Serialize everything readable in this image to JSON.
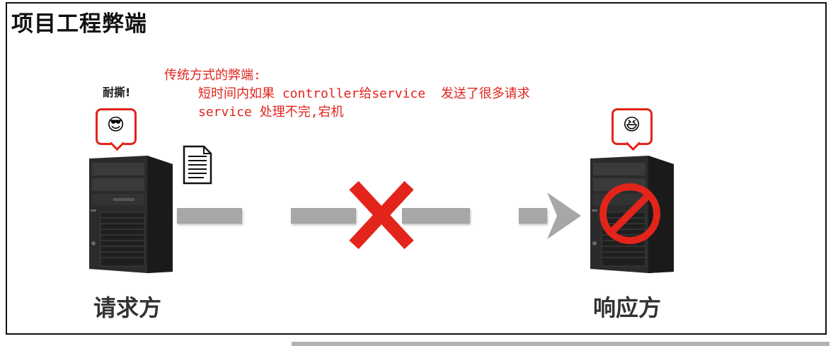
{
  "title": "项目工程弊端",
  "notes": {
    "line1": "传统方式的弊端:",
    "line2": "短时间内如果 controller给service  发送了很多请求",
    "line3": "service 处理不完,宕机"
  },
  "requester": {
    "speech": "耐撕!",
    "label": "请求方",
    "emoji_icon": "cool-face-icon"
  },
  "responder": {
    "label": "响应方",
    "emoji_icon": "crying-laughing-face-icon"
  },
  "colors": {
    "accent_red": "#e3241b",
    "dash_gray": "#a7a7a7",
    "text_dark": "#333333"
  }
}
